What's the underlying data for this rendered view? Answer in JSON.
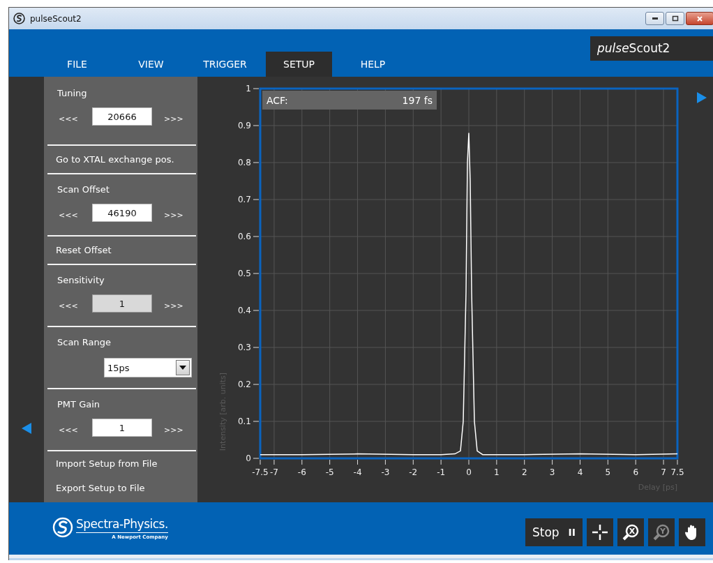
{
  "window": {
    "title": "pulseScout2"
  },
  "brand": {
    "italic_part": "pulse",
    "regular_part": "Scout2"
  },
  "menu": [
    {
      "label": "FILE",
      "selected": false
    },
    {
      "label": "VIEW",
      "selected": false
    },
    {
      "label": "TRIGGER",
      "selected": false
    },
    {
      "label": "SETUP",
      "selected": true
    },
    {
      "label": "HELP",
      "selected": false
    }
  ],
  "sidebar": [
    {
      "kind": "spinner",
      "label": "Tuning",
      "dec": "<<<",
      "value": "20666",
      "inc": ">>>",
      "disabled": false
    },
    {
      "kind": "action",
      "label": "Go to XTAL exchange pos."
    },
    {
      "kind": "spinner",
      "label": "Scan Offset",
      "dec": "<<<",
      "value": "46190",
      "inc": ">>>",
      "disabled": false
    },
    {
      "kind": "action",
      "label": "Reset Offset"
    },
    {
      "kind": "spinner",
      "label": "Sensitivity",
      "dec": "<<<",
      "value": "1",
      "inc": ">>>",
      "disabled": true
    },
    {
      "kind": "dropdown",
      "label": "Scan Range",
      "value": "15ps"
    },
    {
      "kind": "spinner",
      "label": "PMT Gain",
      "dec": "<<<",
      "value": "1",
      "inc": ">>>",
      "disabled": false
    },
    {
      "kind": "action",
      "label": "Import Setup from File"
    },
    {
      "kind": "action",
      "label": "Export Setup to File"
    }
  ],
  "acf": {
    "label": "ACF:",
    "value": "197 fs"
  },
  "chart_data": {
    "type": "line",
    "xlabel": "Delay [ps]",
    "ylabel": "Intensity [arb. units]",
    "x": [
      -7.5,
      -6,
      -4,
      -2,
      -1,
      -0.5,
      -0.3,
      -0.2,
      -0.1,
      -0.05,
      0,
      0.05,
      0.1,
      0.2,
      0.3,
      0.5,
      1,
      2,
      4,
      6,
      7.5
    ],
    "grid": true,
    "series": [
      {
        "color": "#ffffff",
        "values": [
          0.01,
          0.01,
          0.012,
          0.01,
          0.01,
          0.012,
          0.02,
          0.1,
          0.45,
          0.8,
          0.88,
          0.75,
          0.45,
          0.1,
          0.02,
          0.01,
          0.01,
          0.01,
          0.012,
          0.01,
          0.012
        ]
      }
    ],
    "xlim": [
      -7.5,
      7.5
    ],
    "ylim": [
      0,
      1
    ],
    "xticks": [
      -7.5,
      -7,
      -6,
      -5,
      -4,
      -3,
      -2,
      -1,
      0,
      1,
      2,
      3,
      4,
      5,
      6,
      7,
      7.5
    ],
    "yticks": [
      0,
      0.1,
      0.2,
      0.3,
      0.4,
      0.5,
      0.6,
      0.7,
      0.8,
      0.9,
      1
    ]
  },
  "logo": {
    "name": "Spectra-Physics.",
    "tagline": "A Newport Company"
  },
  "controls": {
    "stop": "Stop",
    "pause": "II"
  },
  "tools": [
    {
      "kind": "crosshair",
      "enabled": true
    },
    {
      "kind": "zoom",
      "axis": "X",
      "enabled": true
    },
    {
      "kind": "zoom",
      "axis": "Y",
      "enabled": false
    },
    {
      "kind": "hand",
      "enabled": true
    }
  ]
}
